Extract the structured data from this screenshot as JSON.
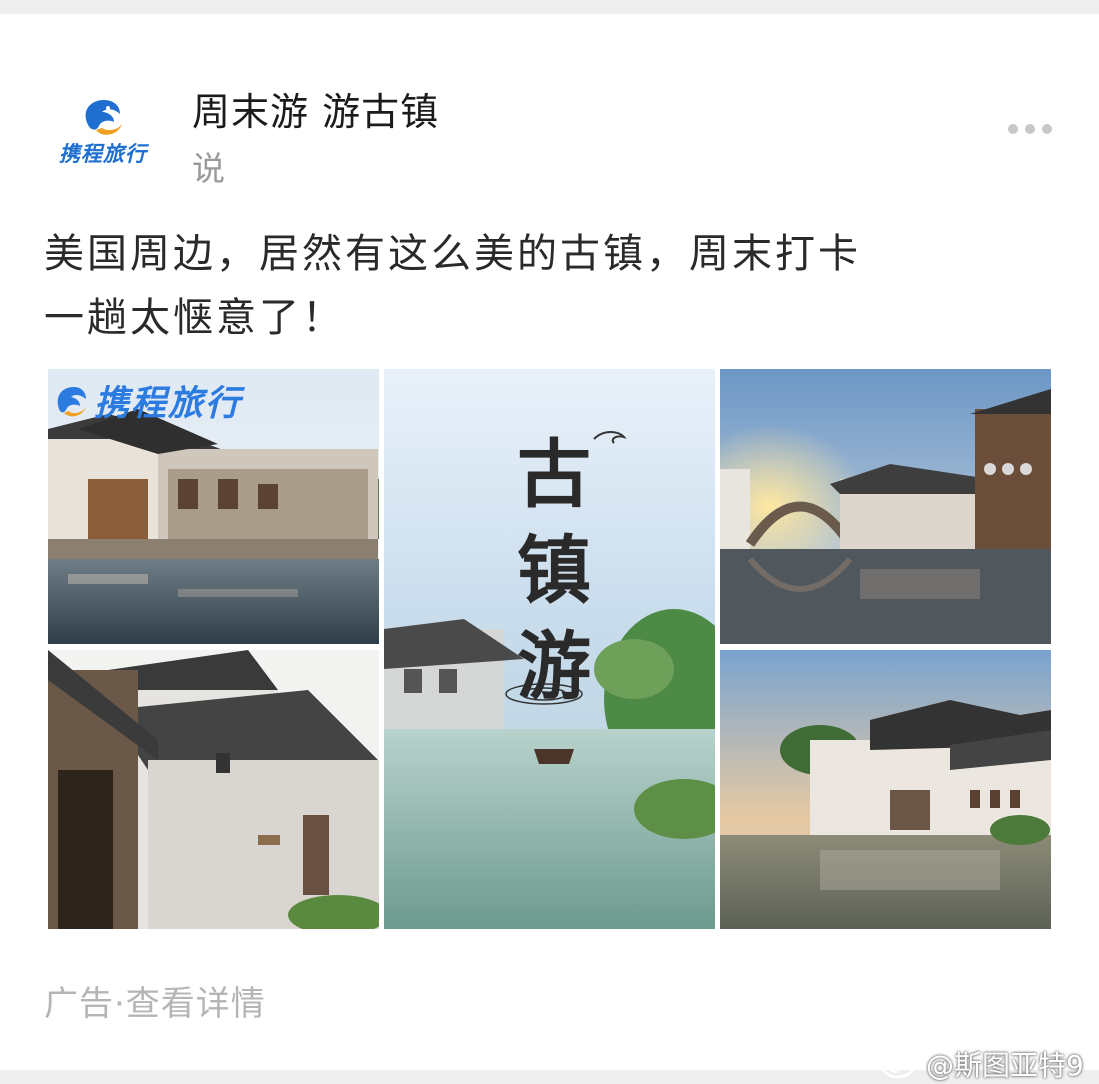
{
  "post": {
    "author_name": "周末游 游古镇",
    "author_action": "说",
    "logo_text": "携程旅行",
    "text_line1": "美国周边，居然有这么美的古镇，周末打卡",
    "text_line2": "一趟太惬意了！",
    "ad_label": "广告·查看详情"
  },
  "images": {
    "brand_overlay": "携程旅行",
    "center_title": [
      "古",
      "镇",
      "游"
    ]
  },
  "watermark": {
    "text": "@斯图亚特9"
  },
  "icons": [
    "dolphin-logo-icon",
    "more-dots-icon",
    "weibo-icon"
  ],
  "colors": {
    "brand_blue": "#1f6fd0",
    "text_dark": "#2a2a2a",
    "text_muted": "#9a9a9a",
    "ad_gray": "#b5b5b5"
  }
}
